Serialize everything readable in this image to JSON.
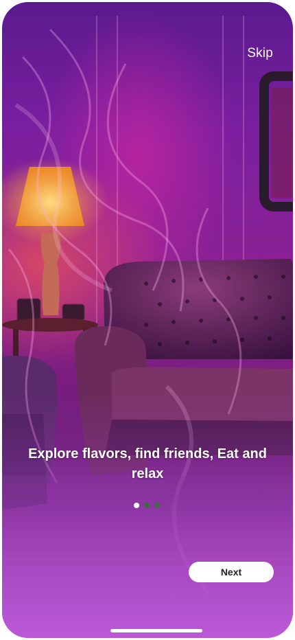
{
  "onboarding": {
    "skip_label": "Skip",
    "headline": "Explore flavors, find friends, Eat and relax",
    "next_label": "Next",
    "page_indicator": {
      "total_pages": 3,
      "active_page": 1
    }
  },
  "colors": {
    "dot_active": "#ffffff",
    "dot_inactive": "#3d6b3f",
    "button_bg": "#ffffff",
    "button_text": "#222222"
  }
}
